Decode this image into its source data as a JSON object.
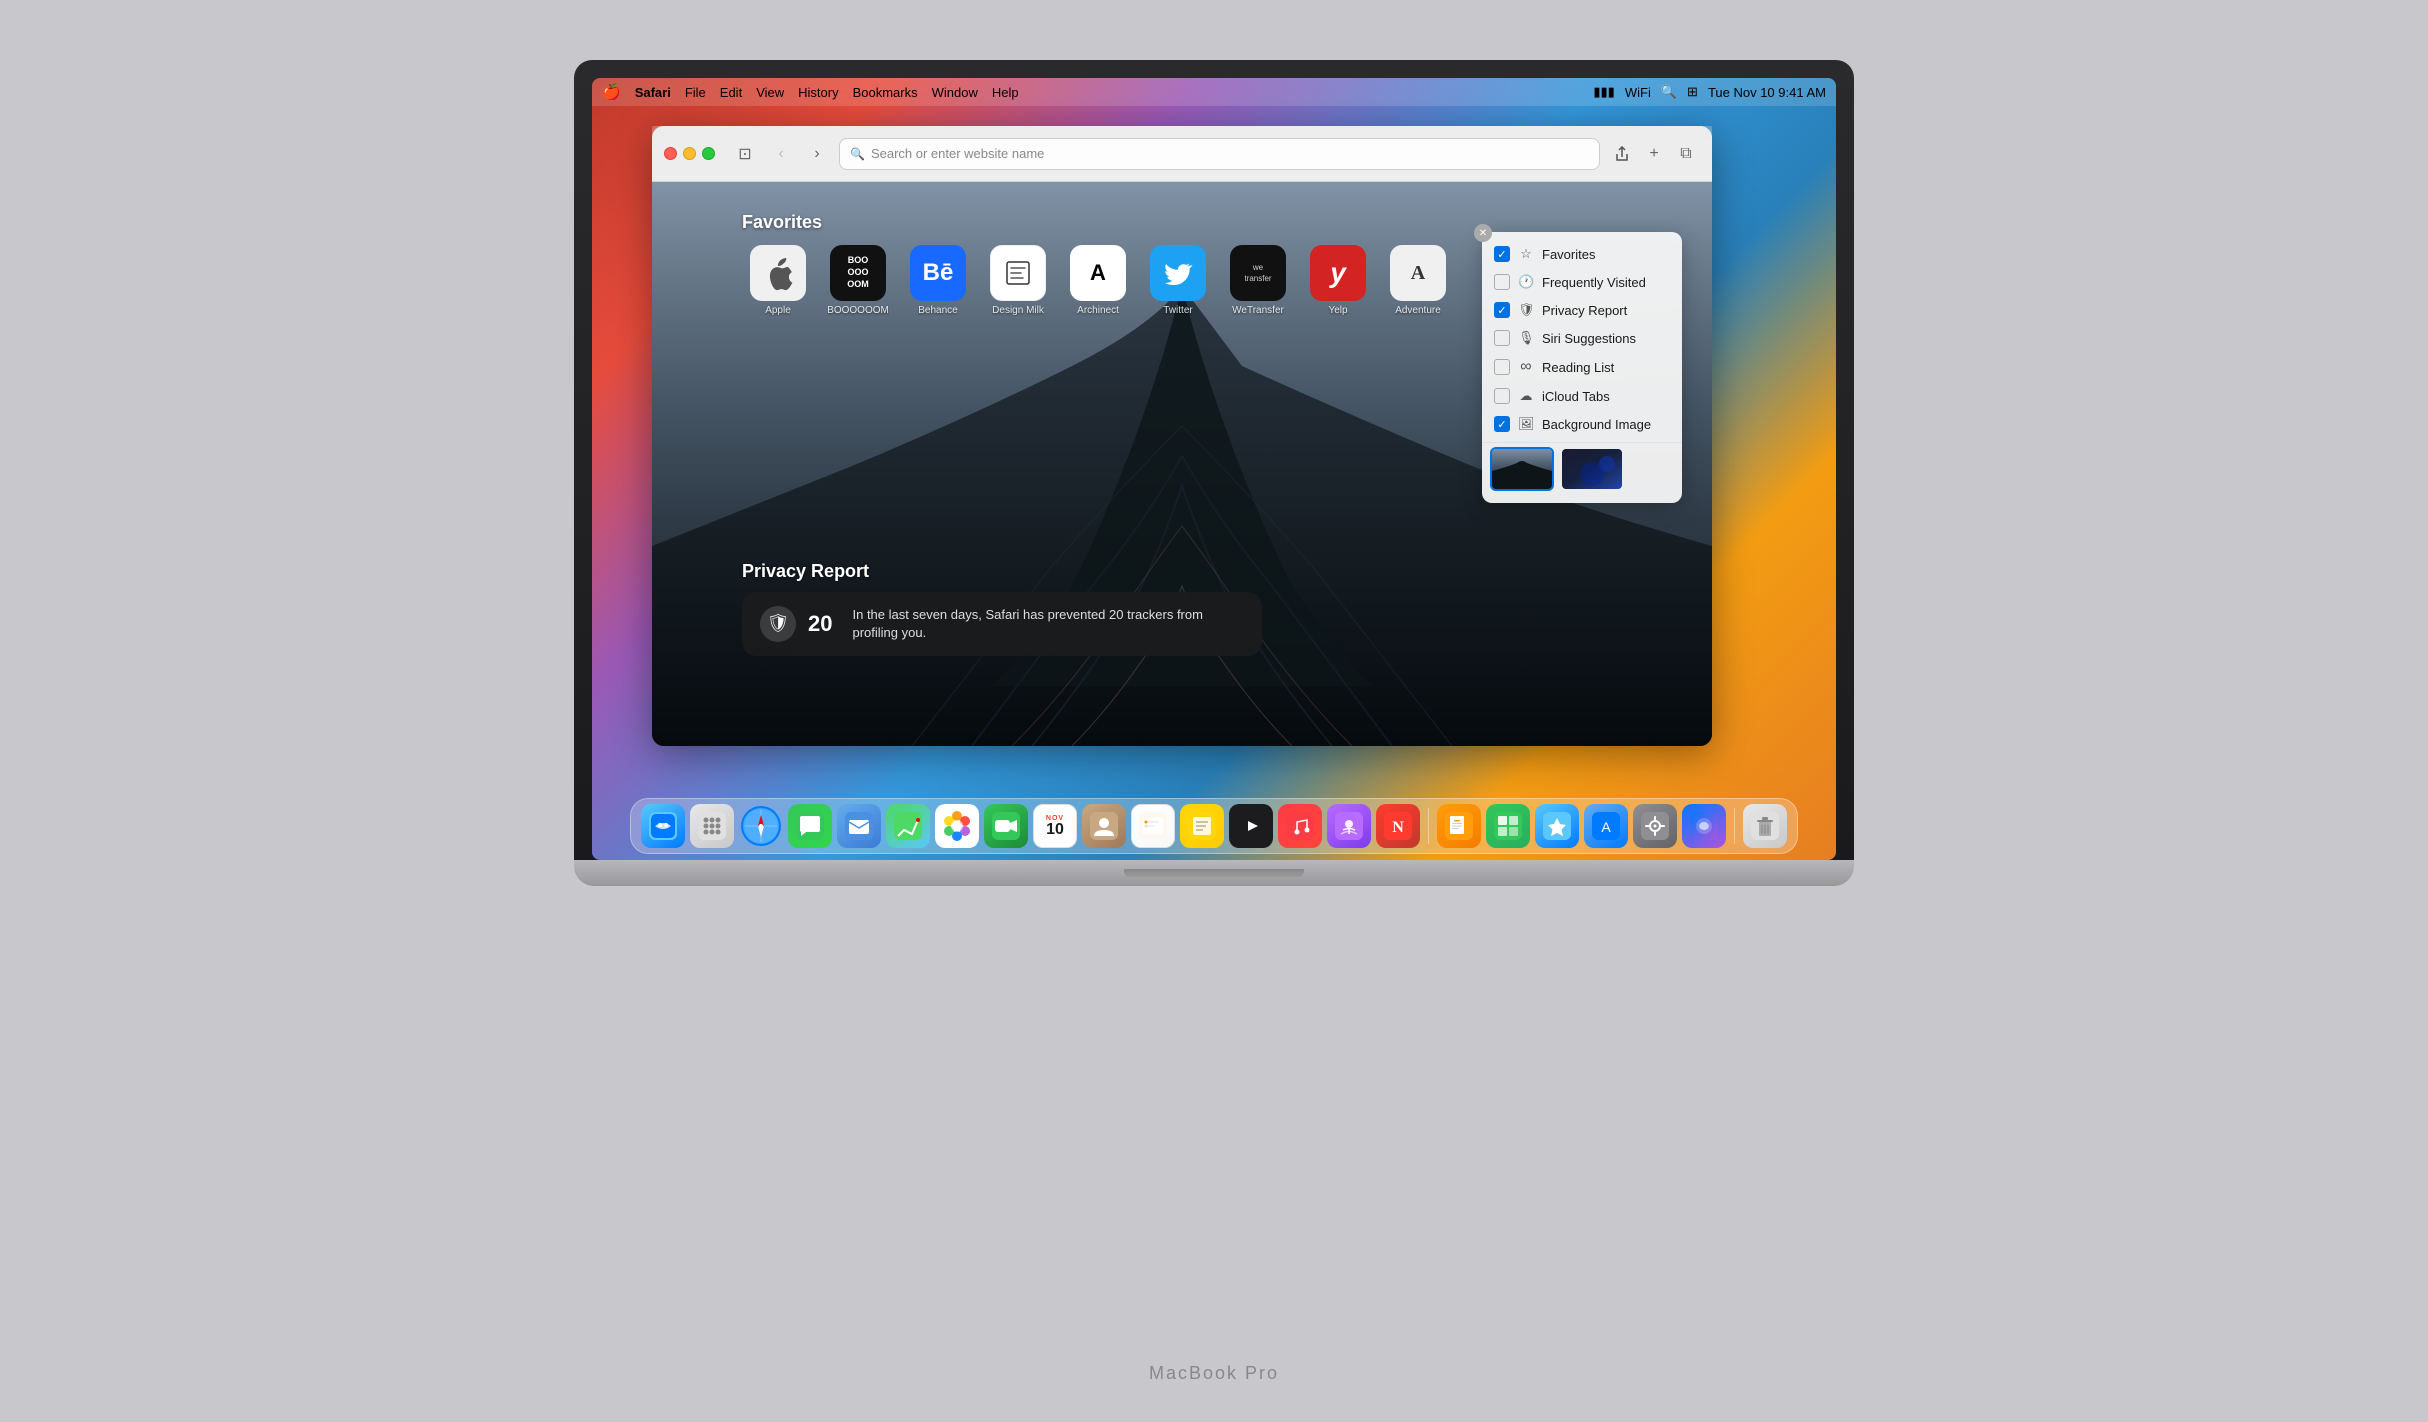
{
  "system": {
    "date": "Tue Nov 10",
    "time": "9:41 AM",
    "laptop_label": "MacBook Pro"
  },
  "menubar": {
    "apple_icon": "🍎",
    "app_name": "Safari",
    "menus": [
      "File",
      "Edit",
      "View",
      "History",
      "Bookmarks",
      "Window",
      "Help"
    ]
  },
  "toolbar": {
    "back_btn": "‹",
    "forward_btn": "›",
    "search_placeholder": "Search or enter website name",
    "share_btn": "↑",
    "newtab_btn": "+",
    "tabs_btn": "⧉"
  },
  "favorites": {
    "title": "Favorites",
    "items": [
      {
        "label": "Apple",
        "icon_type": "apple"
      },
      {
        "label": "BOOOOOOM",
        "icon_type": "boooom"
      },
      {
        "label": "Behance",
        "icon_type": "behance"
      },
      {
        "label": "Design Milk",
        "icon_type": "designmilk"
      },
      {
        "label": "Archinect",
        "icon_type": "archinect"
      },
      {
        "label": "Twitter",
        "icon_type": "twitter"
      },
      {
        "label": "WeTransfer",
        "icon_type": "wetransfer"
      },
      {
        "label": "Yelp",
        "icon_type": "yelp"
      },
      {
        "label": "Adventure",
        "icon_type": "adventure"
      }
    ]
  },
  "privacy_report": {
    "title": "Privacy Report",
    "badge_icon": "🛡",
    "tracker_count": "20",
    "tracker_text": "In the last seven days, Safari has prevented 20 trackers from profiling you."
  },
  "customize_menu": {
    "items": [
      {
        "label": "Favorites",
        "checked": true,
        "icon": "☆"
      },
      {
        "label": "Frequently Visited",
        "checked": false,
        "icon": "🕐"
      },
      {
        "label": "Privacy Report",
        "checked": true,
        "icon": "🛡"
      },
      {
        "label": "Siri Suggestions",
        "checked": false,
        "icon": "🎙"
      },
      {
        "label": "Reading List",
        "checked": false,
        "icon": "∞"
      },
      {
        "label": "iCloud Tabs",
        "checked": false,
        "icon": "☁"
      },
      {
        "label": "Background Image",
        "checked": true,
        "icon": "🖼"
      }
    ]
  },
  "dock": {
    "apps": [
      {
        "name": "Finder",
        "icon": "😊"
      },
      {
        "name": "Launchpad",
        "icon": "⬛"
      },
      {
        "name": "Safari",
        "icon": "◎"
      },
      {
        "name": "Messages",
        "icon": "💬"
      },
      {
        "name": "Mail",
        "icon": "✉"
      },
      {
        "name": "Maps",
        "icon": "🗺"
      },
      {
        "name": "Photos",
        "icon": "🌸"
      },
      {
        "name": "FaceTime",
        "icon": "📹"
      },
      {
        "name": "Calendar",
        "icon": "10",
        "date": "NOV"
      },
      {
        "name": "Contacts",
        "icon": "👤"
      },
      {
        "name": "Reminders",
        "icon": "☑"
      },
      {
        "name": "Notes",
        "icon": "📝"
      },
      {
        "name": "Apple TV",
        "icon": "▶"
      },
      {
        "name": "Music",
        "icon": "♪"
      },
      {
        "name": "Podcasts",
        "icon": "🎙"
      },
      {
        "name": "News",
        "icon": "N"
      },
      {
        "name": "Pages",
        "icon": "📄"
      },
      {
        "name": "Numbers",
        "icon": "⊞"
      },
      {
        "name": "Keynote",
        "icon": "★"
      },
      {
        "name": "App Store",
        "icon": "A"
      },
      {
        "name": "System Preferences",
        "icon": "⚙"
      },
      {
        "name": "Siri",
        "icon": "◎"
      },
      {
        "name": "Trash",
        "icon": "🗑"
      }
    ]
  }
}
